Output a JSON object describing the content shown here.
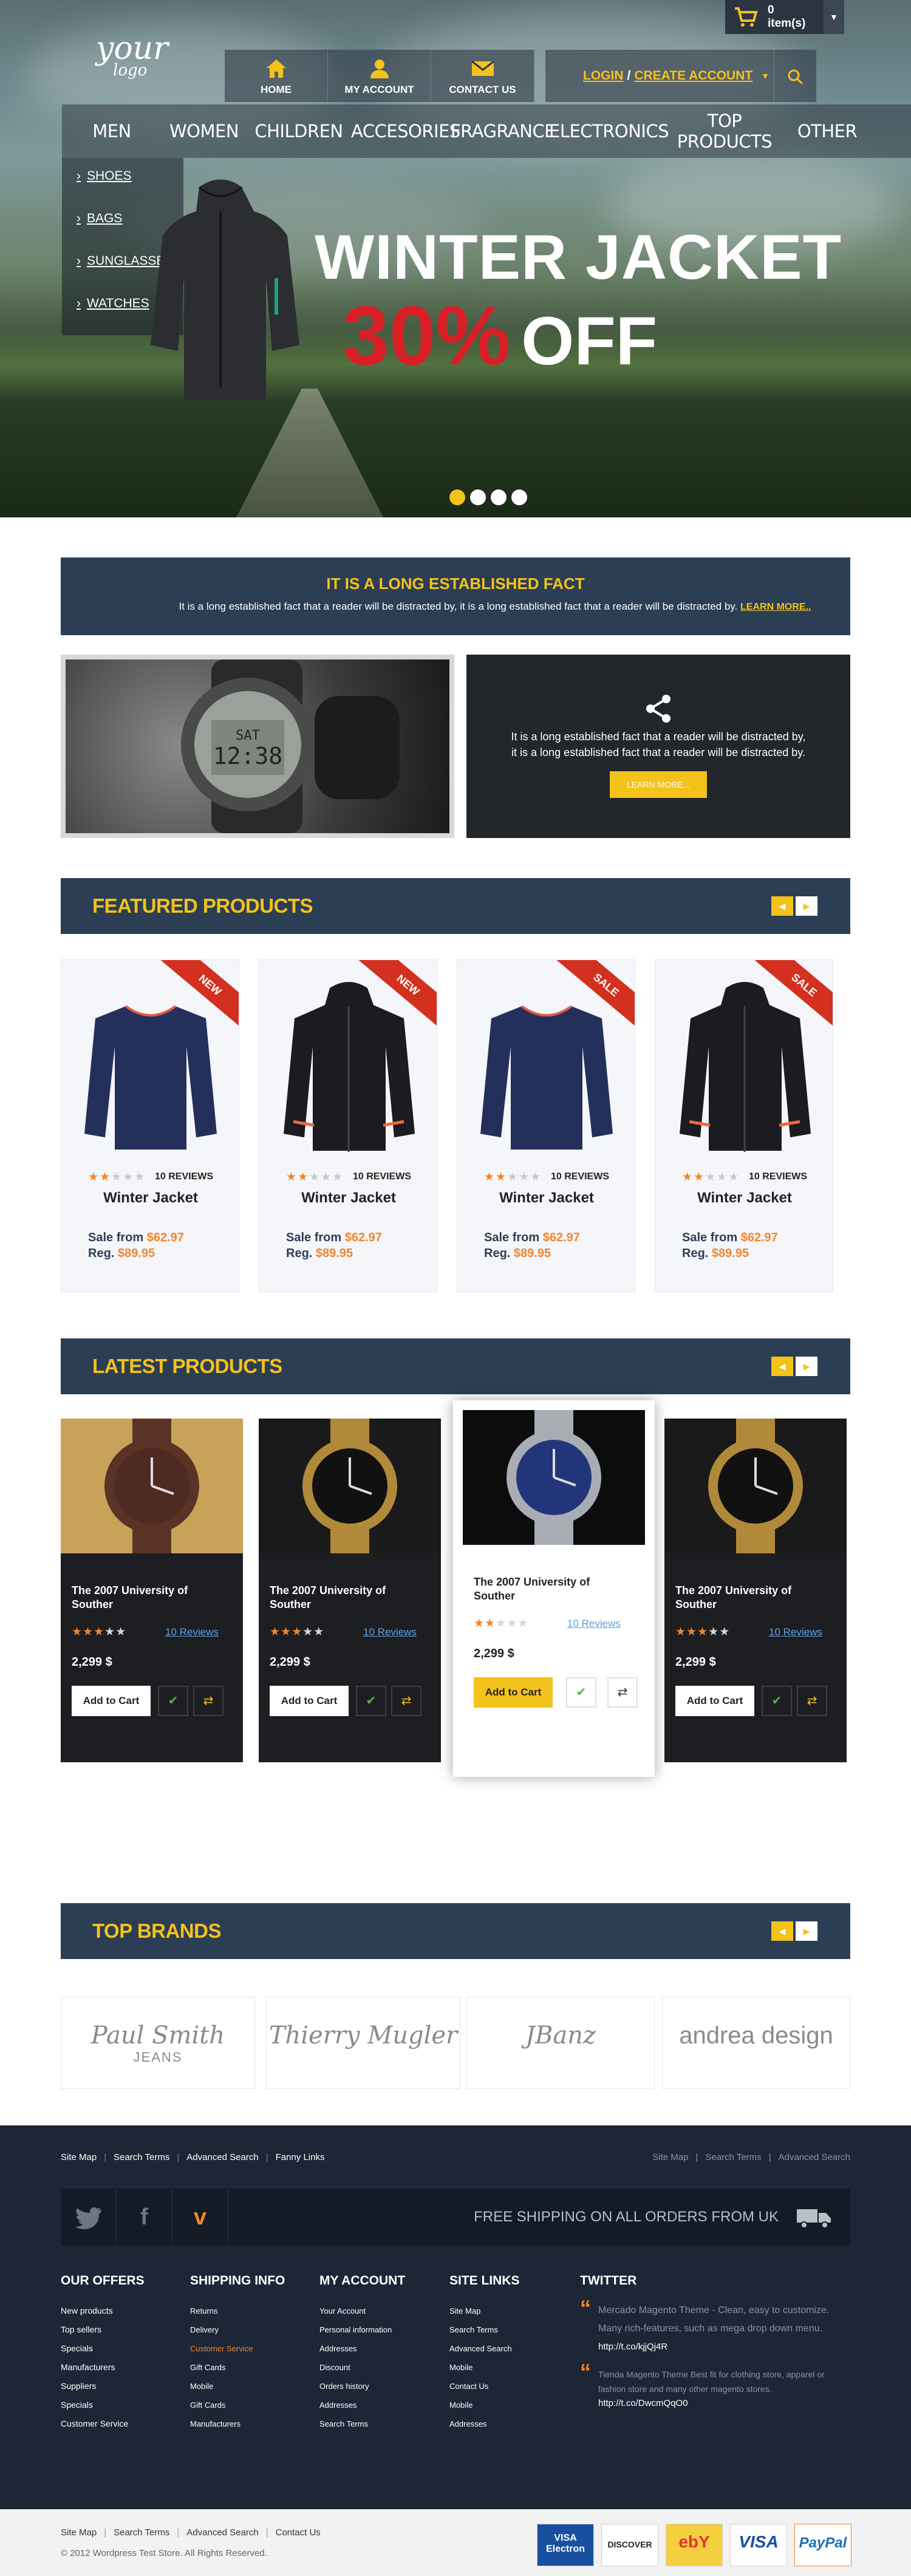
{
  "header": {
    "cart_count": "0",
    "cart_label": "item(s)",
    "logo_line1": "your",
    "logo_line2": "logo",
    "top_links": [
      {
        "label": "HOME",
        "icon": "home-icon"
      },
      {
        "label": "MY ACCOUNT",
        "icon": "user-icon"
      },
      {
        "label": "CONTACT US",
        "icon": "envelope-icon"
      }
    ],
    "login": "LOGIN",
    "separator": "/",
    "create_account": "CREATE ACCOUNT"
  },
  "nav": {
    "items": [
      "MEN",
      "WOMEN",
      "CHILDREN",
      "ACCESORIES",
      "FRAGRANCE",
      "ELECTRONICS",
      "TOP PRODUCTS",
      "OTHER"
    ],
    "submenu": [
      "SHOES",
      "BAGS",
      "SUNGLASSES",
      "WATCHES"
    ]
  },
  "hero": {
    "title": "WINTER JACKET",
    "discount": "30%",
    "off": "OFF",
    "slides": 4,
    "active_slide": 1
  },
  "banner": {
    "title": "IT IS A LONG ESTABLISHED FACT",
    "text": "It is a long established fact that a reader will be distracted by, it is a long established fact that a reader will be distracted by.",
    "link": "LEARN MORE.."
  },
  "promo": {
    "text": "It is a long established fact that a reader will be distracted by, it is a long established fact that a reader will be distracted by.",
    "button": "LEARN MORE..."
  },
  "featured": {
    "title": "FEATURED PRODUCTS",
    "products": [
      {
        "badge": "NEW",
        "name": "Winter Jacket",
        "rating": 2,
        "reviews": "10 REVIEWS",
        "sale_label": "Sale from",
        "sale": "$62.97",
        "reg_label": "Reg.",
        "reg": "$89.95",
        "image": "navy-sweater"
      },
      {
        "badge": "NEW",
        "name": "Winter Jacket",
        "rating": 2,
        "reviews": "10 REVIEWS",
        "sale_label": "Sale from",
        "sale": "$62.97",
        "reg_label": "Reg.",
        "reg": "$89.95",
        "image": "black-jacket"
      },
      {
        "badge": "SALE",
        "name": "Winter Jacket",
        "rating": 2,
        "reviews": "10 REVIEWS",
        "sale_label": "Sale from",
        "sale": "$62.97",
        "reg_label": "Reg.",
        "reg": "$89.95",
        "image": "navy-sweater"
      },
      {
        "badge": "SALE",
        "name": "Winter Jacket",
        "rating": 2,
        "reviews": "10 REVIEWS",
        "sale_label": "Sale from",
        "sale": "$62.97",
        "reg_label": "Reg.",
        "reg": "$89.95",
        "image": "black-jacket"
      }
    ]
  },
  "latest": {
    "title": "LATEST PRODUCTS",
    "products": [
      {
        "name": "The 2007 University of Souther",
        "rating": 3,
        "reviews": "10 Reviews",
        "price": "2,299 $",
        "button": "Add to Cart",
        "image": "brown-watch"
      },
      {
        "name": "The 2007 University of Souther",
        "rating": 3,
        "reviews": "10 Reviews",
        "price": "2,299 $",
        "button": "Add to Cart",
        "image": "gold-watch"
      },
      {
        "name": "The 2007 University of Souther",
        "rating": 2,
        "reviews": "10 Reviews",
        "price": "2,299 $",
        "button": "Add to Cart",
        "image": "silver-watch"
      },
      {
        "name": "The 2007 University of Souther",
        "rating": 3,
        "reviews": "10 Reviews",
        "price": "2,299 $",
        "button": "Add to Cart",
        "image": "gold-watch"
      }
    ]
  },
  "brands": {
    "title": "TOP BRANDS",
    "items": [
      {
        "name": "Paul Smith",
        "sub": "JEANS"
      },
      {
        "name": "Thierry Mugler",
        "sub": ""
      },
      {
        "name": "JBanz",
        "sub": ""
      },
      {
        "name": "andrea design",
        "sub": ""
      }
    ]
  },
  "footer": {
    "links_left": [
      "Site Map",
      "Search Terms",
      "Advanced Search",
      "Fanny Links"
    ],
    "links_right": [
      "Site Map",
      "Search Terms",
      "Advanced Search"
    ],
    "shipping": "FREE SHIPPING ON ALL ORDERS FROM UK",
    "social": [
      "twitter-icon",
      "facebook-icon",
      "vimeo-icon"
    ],
    "columns": [
      {
        "title": "OUR OFFERS",
        "items": [
          "New products",
          "Top sellers",
          "Specials",
          "Manufacturers",
          "Suppliers",
          "Specials",
          "Customer Service"
        ]
      },
      {
        "title": "SHIPPING INFO",
        "items": [
          "Returns",
          "Delivery",
          "Customer Service",
          "Gift Cards",
          "Mobile",
          "Gift Cards",
          "Manufacturers"
        ]
      },
      {
        "title": "MY ACCOUNT",
        "items": [
          "Your Account",
          "Personal information",
          "Addresses",
          "Discount",
          "Orders history",
          "Addresses",
          "Search Terms"
        ]
      },
      {
        "title": "SITE LINKS",
        "items": [
          "Site Map",
          "Search Terms",
          "Advanced Search",
          "Mobile",
          "Contact Us",
          "Mobile",
          "Addresses"
        ]
      }
    ],
    "twitter": {
      "title": "TWITTER",
      "tweets": [
        {
          "text": "Mercado Magento Theme - Clean, easy to customize. Many rich-features, such as mega drop down menu.",
          "link": "http://t.co/kjjQj4R"
        },
        {
          "text": "Tienda Magento Theme Best fit for clothing store, apparel or fashion store and many other magento stores.",
          "link": "http://t.co/DwcmQqO0"
        }
      ]
    },
    "bottom_links": [
      "Site Map",
      "Search Terms",
      "Advanced Search",
      "Contact Us"
    ],
    "copyright": "© 2012 Wordpress Test Store. All Rights Reserved.",
    "payments": [
      "VISA Electron",
      "DISCOVER",
      "ebY",
      "VISA",
      "PayPal"
    ]
  },
  "colors": {
    "accent": "#f3c21b",
    "navy": "#2c3e54",
    "orange": "#f1852c",
    "red": "#d91f26",
    "footer": "#1d2636"
  }
}
